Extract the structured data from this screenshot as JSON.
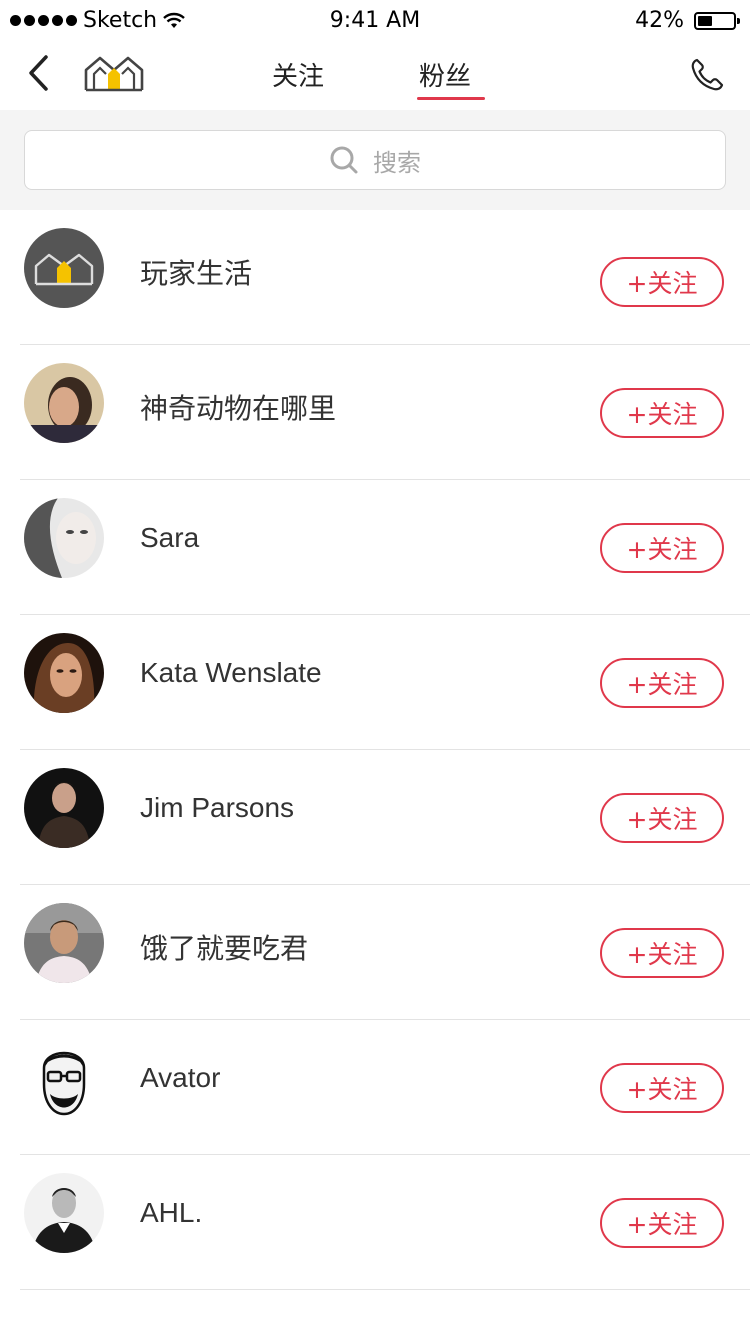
{
  "status_bar": {
    "carrier": "Sketch",
    "time": "9:41 AM",
    "battery": "42%",
    "battery_level": 0.42
  },
  "nav": {
    "tabs": [
      "关注",
      "粉丝"
    ],
    "active_tab_index": 1,
    "icons": {
      "back": "chevron-left-icon",
      "logo": "home-logo-icon",
      "phone": "phone-icon"
    }
  },
  "search": {
    "placeholder": "搜索",
    "icon": "search-icon"
  },
  "colors": {
    "accent": "#e0384b",
    "search_bg": "#f4f4f4",
    "divider": "#e3e3e3",
    "text": "#333333"
  },
  "fans": [
    {
      "name": "玩家生活",
      "follow_label": "+关注",
      "avatar": "brand-logo-avatar"
    },
    {
      "name": "神奇动物在哪里",
      "follow_label": "+关注",
      "avatar": "photo-avatar"
    },
    {
      "name": "Sara",
      "follow_label": "+关注",
      "avatar": "photo-avatar"
    },
    {
      "name": "Kata Wenslate",
      "follow_label": "+关注",
      "avatar": "photo-avatar"
    },
    {
      "name": "Jim Parsons",
      "follow_label": "+关注",
      "avatar": "photo-avatar"
    },
    {
      "name": "饿了就要吃君",
      "follow_label": "+关注",
      "avatar": "photo-avatar"
    },
    {
      "name": "Avator",
      "follow_label": "+关注",
      "avatar": "illustrated-avatar"
    },
    {
      "name": "AHL.",
      "follow_label": "+关注",
      "avatar": "photo-avatar"
    }
  ]
}
